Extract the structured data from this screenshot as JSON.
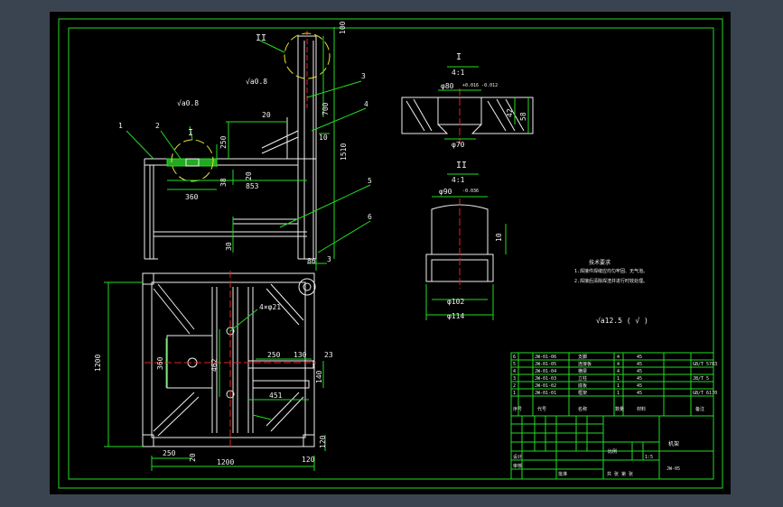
{
  "drawing": {
    "balloons": [
      "1",
      "2",
      "3",
      "4",
      "5",
      "6"
    ],
    "detail_roman": [
      "I",
      "II"
    ],
    "roughness_a": "√a0.8",
    "roughness_b": "√a0.8",
    "roughness_note": "√a12.5 ( √ )",
    "front_dims": {
      "d100": "100",
      "d700": "700",
      "d1510": "1510",
      "d250": "250",
      "d20a": "20",
      "d20b": "20",
      "d38": "38",
      "d360": "360",
      "d853": "853",
      "d10": "10",
      "d30": "30",
      "d86": "86",
      "d3": "3"
    },
    "plan_dims": {
      "d1200v": "1200",
      "d1200h": "1200",
      "d250b": "250",
      "d20c": "20",
      "d120a": "120",
      "d120b": "120",
      "d360v": "360",
      "d462": "462",
      "d250c": "250",
      "d130": "130",
      "d23": "23",
      "d140": "140",
      "d451": "451",
      "holes": "4×φ21"
    },
    "detail_I": {
      "scale": "4:1",
      "dia_top": "φ80",
      "tol_top": "+0.016  -0.012",
      "dia_bottom": "φ70",
      "d42": "42",
      "d58": "58"
    },
    "detail_II": {
      "scale": "4:1",
      "dia_top": "φ90",
      "tol_top": "-0.036",
      "d10": "10",
      "dia_mid": "φ102",
      "dia_bottom": "φ114"
    },
    "tech_req": {
      "title": "技术要求",
      "line1": "1.焊接件焊缝应均匀牢固、无气泡。",
      "line2": "2.焊接后清除焊渣并进行时效处理。"
    }
  },
  "title_block": {
    "parts": [
      {
        "no": "6",
        "code": "JW-01-06",
        "name": "支脚",
        "qty": "4",
        "mat": "45",
        "note": ""
      },
      {
        "no": "5",
        "code": "JW-01-05",
        "name": "连接板",
        "qty": "4",
        "mat": "45",
        "note": "GB/T 5783"
      },
      {
        "no": "4",
        "code": "JW-01-04",
        "name": "横梁",
        "qty": "4",
        "mat": "45",
        "note": ""
      },
      {
        "no": "3",
        "code": "JW-01-03",
        "name": "立柱",
        "qty": "1",
        "mat": "45",
        "note": "JB/T 5"
      },
      {
        "no": "2",
        "code": "JW-01-02",
        "name": "底板",
        "qty": "1",
        "mat": "45",
        "note": ""
      },
      {
        "no": "1",
        "code": "JW-01-01",
        "name": "框架",
        "qty": "1",
        "mat": "45",
        "note": "GB/T 6170"
      }
    ],
    "headers": {
      "no": "序号",
      "code": "代号",
      "name": "名称",
      "qty": "数量",
      "mat": "材料",
      "note": "备注"
    },
    "drawing_name": "机架",
    "drawing_code": "JW-05",
    "scale_label": "比例",
    "scale_value": "1:5",
    "sheet": "共 张 第 张",
    "designer": "设计",
    "checker": "审核",
    "approve": "批准"
  }
}
